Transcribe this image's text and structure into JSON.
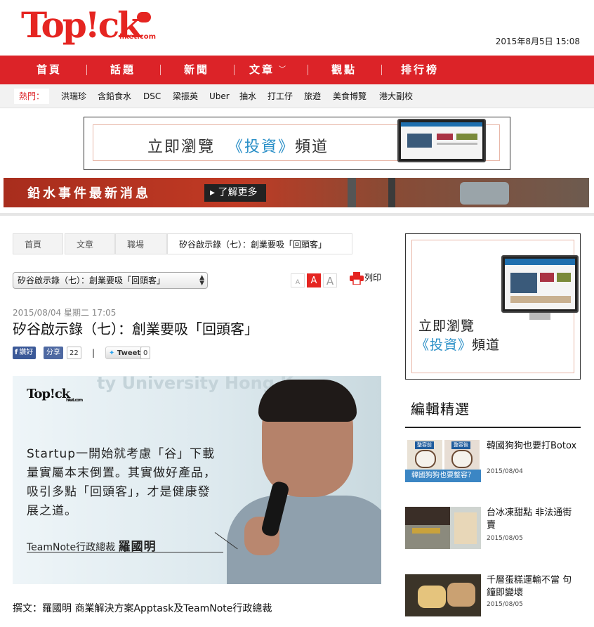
{
  "site": {
    "logo_text": "Top!ck",
    "logo_sub": "hket.com",
    "datetime": "2015年8月5日 15:08"
  },
  "nav": {
    "items": [
      "首頁",
      "話題",
      "新聞",
      "文章",
      "觀點",
      "排行榜"
    ],
    "dropdown_caret": "﹀"
  },
  "hot": {
    "label": "熱門：",
    "items": [
      "洪瑞珍",
      "含鉛食水",
      "DSC",
      "梁振英",
      "Uber",
      "抽水",
      "打工仔",
      "旅遊",
      "美食博覽",
      "港大副校"
    ]
  },
  "banner_ad": {
    "text_before": "立即瀏覽",
    "highlight": "《投資》",
    "text_after": "頻道"
  },
  "lead_strip": {
    "title": "鉛水事件最新消息",
    "more_label": "▸ 了解更多"
  },
  "breadcrumb": {
    "items": [
      "首頁",
      "文章",
      "職場",
      "矽谷啟示錄（七）：創業要吸「回頭客」"
    ]
  },
  "article_select": {
    "value": "矽谷啟示錄（七）：創業要吸「回頭客」"
  },
  "font_size": {
    "small": "A",
    "medium": "A",
    "large": "A",
    "active": "medium"
  },
  "print_label": "列印",
  "article": {
    "meta": "2015/08/04 星期二 17:05",
    "headline": "矽谷啟示錄（七）：創業要吸「回頭客」",
    "author": "撰文：羅國明 商業解決方案Apptask及TeamNote行政總裁"
  },
  "share": {
    "fb_label": "讚好",
    "share_label": "分享",
    "share_count": "22",
    "tweet_label": "Tweet",
    "tweet_count": "0",
    "separator": "|"
  },
  "hero": {
    "watermark": "ty University Hong Ko",
    "logo": "Top!ck",
    "logo_sub": "hket.com",
    "quote": "Startup一開始就考慮「谷」下載量實屬本末倒置。其實做好產品，吸引多點「回頭客」，才是健康發展之道。",
    "byline_role": "TeamNote行政總裁",
    "byline_name": "羅國明"
  },
  "side_ad": {
    "line1": "立即瀏覽",
    "highlight": "《投資》",
    "line2_after": "頻道"
  },
  "editor_picks": {
    "heading": "編輯精選",
    "items": [
      {
        "title": "韓國狗狗也要打Botox",
        "date": "2015/08/04",
        "thumb_tag_left": "整容前",
        "thumb_tag_right": "整容後",
        "thumb_caption": "韓國狗狗也要整容？"
      },
      {
        "title": "台冰凍甜點 非法通街賣",
        "date": "2015/08/05"
      },
      {
        "title": "千層蛋糕運輸不當 句鐘即變壞",
        "date": "2015/08/05"
      }
    ]
  },
  "colors": {
    "brand_red": "#dc2328",
    "accent_blue": "#2a8fc7",
    "facebook": "#3b5998"
  }
}
